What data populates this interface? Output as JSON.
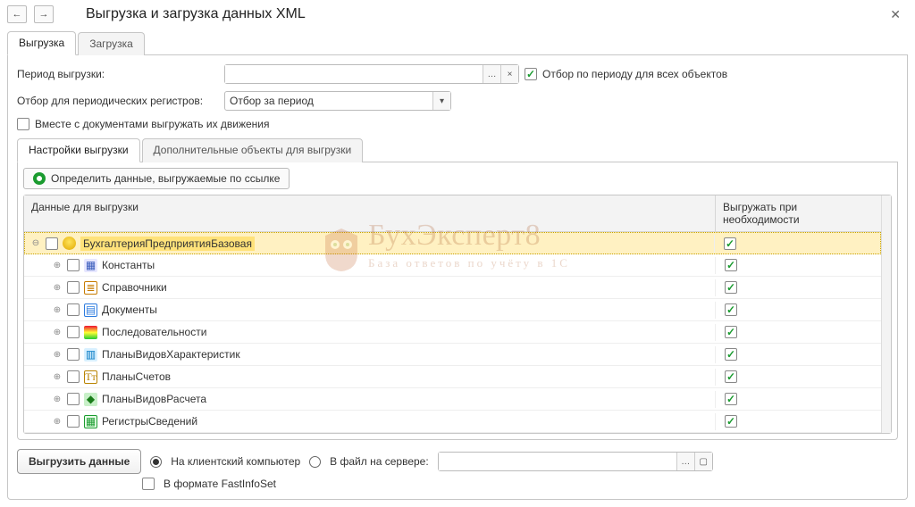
{
  "window": {
    "title": "Выгрузка и загрузка данных XML"
  },
  "tabs": {
    "export": "Выгрузка",
    "import": "Загрузка"
  },
  "fields": {
    "period_label": "Период выгрузки:",
    "period_value": "",
    "filter_all_label": "Отбор по периоду для всех объектов",
    "filter_all_checked": true,
    "register_filter_label": "Отбор для периодических регистров:",
    "register_filter_value": "Отбор за период",
    "with_movements_label": "Вместе с документами выгружать их движения",
    "with_movements_checked": false
  },
  "sub_tabs": {
    "settings": "Настройки выгрузки",
    "additional": "Дополнительные объекты для выгрузки"
  },
  "toolbar": {
    "determine_label": "Определить данные, выгружаемые по ссылке"
  },
  "grid": {
    "col_data": "Данные для выгрузки",
    "col_need": "Выгружать при необходимости",
    "rows": [
      {
        "label": "БухгалтерияПредприятияБазовая",
        "level": 0,
        "icon": "ic-db",
        "checked": false,
        "need_checked": true,
        "selected": true
      },
      {
        "label": "Константы",
        "level": 1,
        "icon": "ic-const",
        "checked": false,
        "need_checked": true
      },
      {
        "label": "Справочники",
        "level": 1,
        "icon": "ic-spr",
        "checked": false,
        "need_checked": true
      },
      {
        "label": "Документы",
        "level": 1,
        "icon": "ic-doc",
        "checked": false,
        "need_checked": true
      },
      {
        "label": "Последовательности",
        "level": 1,
        "icon": "ic-seq",
        "checked": false,
        "need_checked": true
      },
      {
        "label": "ПланыВидовХарактеристик",
        "level": 1,
        "icon": "ic-pvh",
        "checked": false,
        "need_checked": true
      },
      {
        "label": "ПланыСчетов",
        "level": 1,
        "icon": "ic-psch",
        "checked": false,
        "need_checked": true
      },
      {
        "label": "ПланыВидовРасчета",
        "level": 1,
        "icon": "ic-pvr",
        "checked": false,
        "need_checked": true
      },
      {
        "label": "РегистрыСведений",
        "level": 1,
        "icon": "ic-rs",
        "checked": false,
        "need_checked": true
      }
    ]
  },
  "bottom": {
    "export_button": "Выгрузить данные",
    "radio_client_label": "На клиентский компьютер",
    "radio_server_label": "В файл на сервере:",
    "radio_selected": "client",
    "server_path_value": "",
    "fastinfoset_label": "В формате FastInfoSet",
    "fastinfoset_checked": false
  },
  "watermark": {
    "title": "БухЭксперт8",
    "subtitle": "База ответов по учёту в 1С"
  },
  "icon_glyphs": {
    "ic-const": "▦",
    "ic-spr": "≣",
    "ic-doc": "▤",
    "ic-seq": "",
    "ic-pvh": "▥",
    "ic-psch": "Тт",
    "ic-pvr": "◆",
    "ic-rs": "▦",
    "ic-db": ""
  }
}
